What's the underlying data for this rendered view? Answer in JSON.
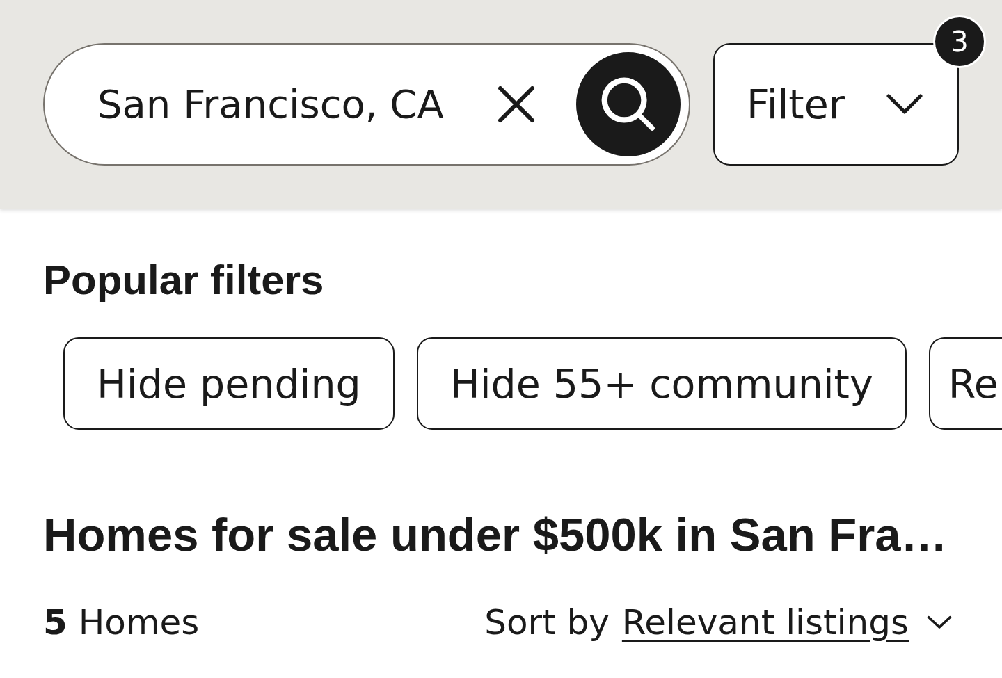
{
  "search": {
    "value": "San Francisco, CA"
  },
  "filter_button": {
    "label": "Filter",
    "badge": "3"
  },
  "popular_filters": {
    "title": "Popular filters",
    "chips": [
      {
        "label": "Hide pending",
        "selected": false
      },
      {
        "label": "Hide 55+ community",
        "selected": false
      },
      {
        "label": "Re",
        "selected": false
      }
    ]
  },
  "results": {
    "title": "Homes for sale under $500k in San Fra…",
    "count": "**5** Homes",
    "sort_label": "Sort by",
    "sort_value": "Relevant listings"
  }
}
